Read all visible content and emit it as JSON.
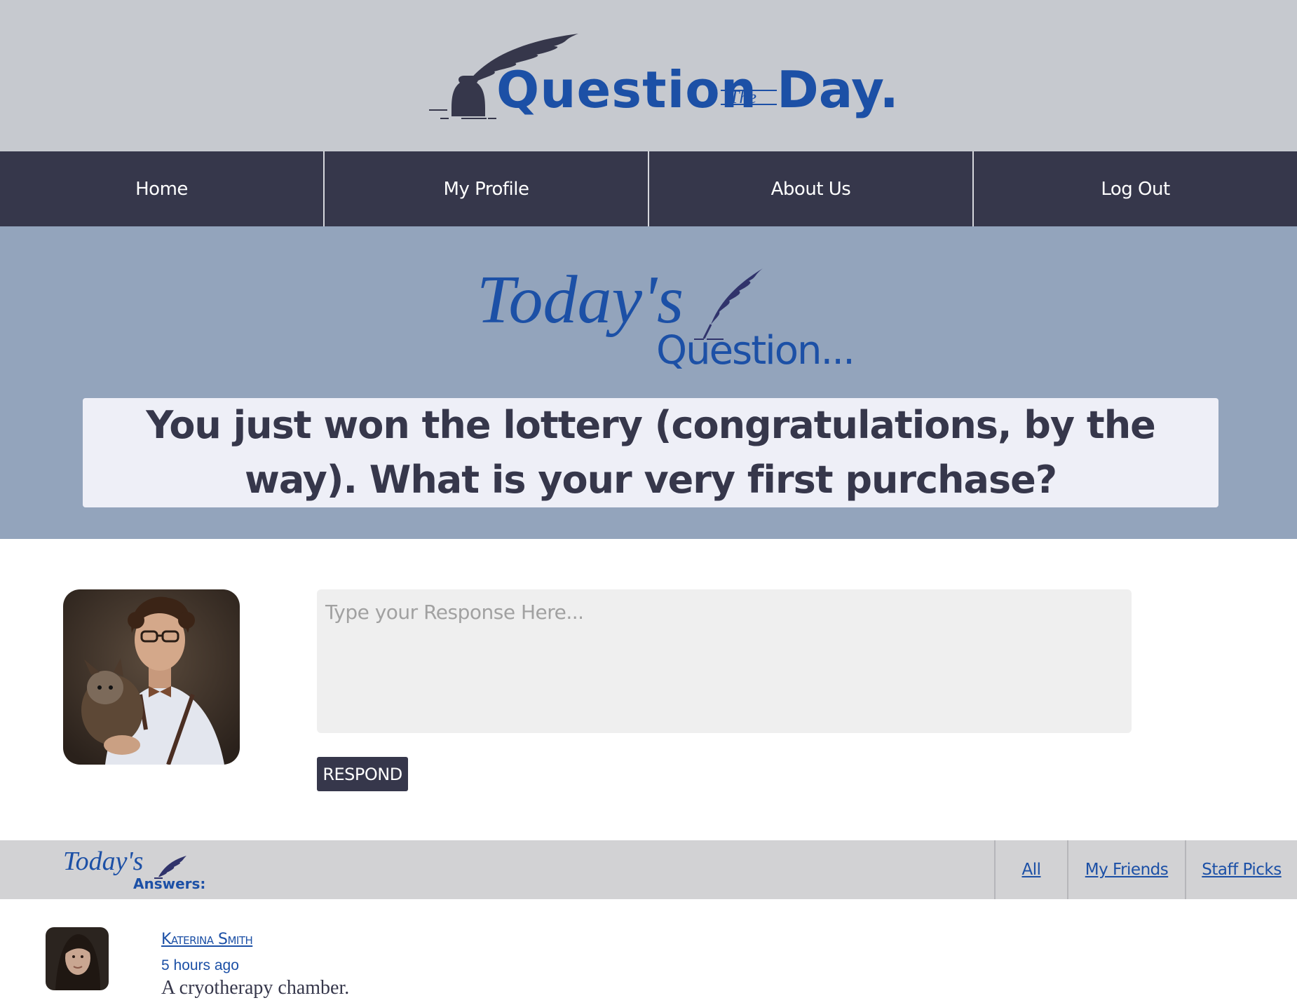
{
  "header": {
    "logo": {
      "word_question": "Question",
      "word_the": "The",
      "word_day": "Day."
    }
  },
  "nav": {
    "items": [
      {
        "label": "Home"
      },
      {
        "label": "My Profile"
      },
      {
        "label": "About Us"
      },
      {
        "label": "Log Out"
      }
    ]
  },
  "hero": {
    "title_line1": "Today's",
    "title_line2": "Question...",
    "question": "You just won the lottery (congratulations, by the way). What is your very first purchase?"
  },
  "response": {
    "placeholder": "Type your Response Here...",
    "button_label": "RESPOND"
  },
  "answers": {
    "title_line1": "Today's",
    "title_line2": "Answers:",
    "filters": [
      {
        "label": "All"
      },
      {
        "label": "My Friends"
      },
      {
        "label": "Staff Picks"
      }
    ],
    "items": [
      {
        "author": "Katerina Smith",
        "time": "5 hours ago",
        "text": "A cryotherapy chamber."
      }
    ]
  },
  "colors": {
    "brand_blue": "#1c50a6",
    "nav_bg": "#36374b",
    "header_bg": "#c6c9cf",
    "hero_bg": "#93a4bc",
    "question_box_bg": "#eeeff7",
    "answers_bar_bg": "#d2d2d4"
  },
  "icons": {
    "logo_art": "ink-bottle-quill-icon",
    "title_quill": "quill-icon",
    "answers_quill": "quill-icon"
  }
}
